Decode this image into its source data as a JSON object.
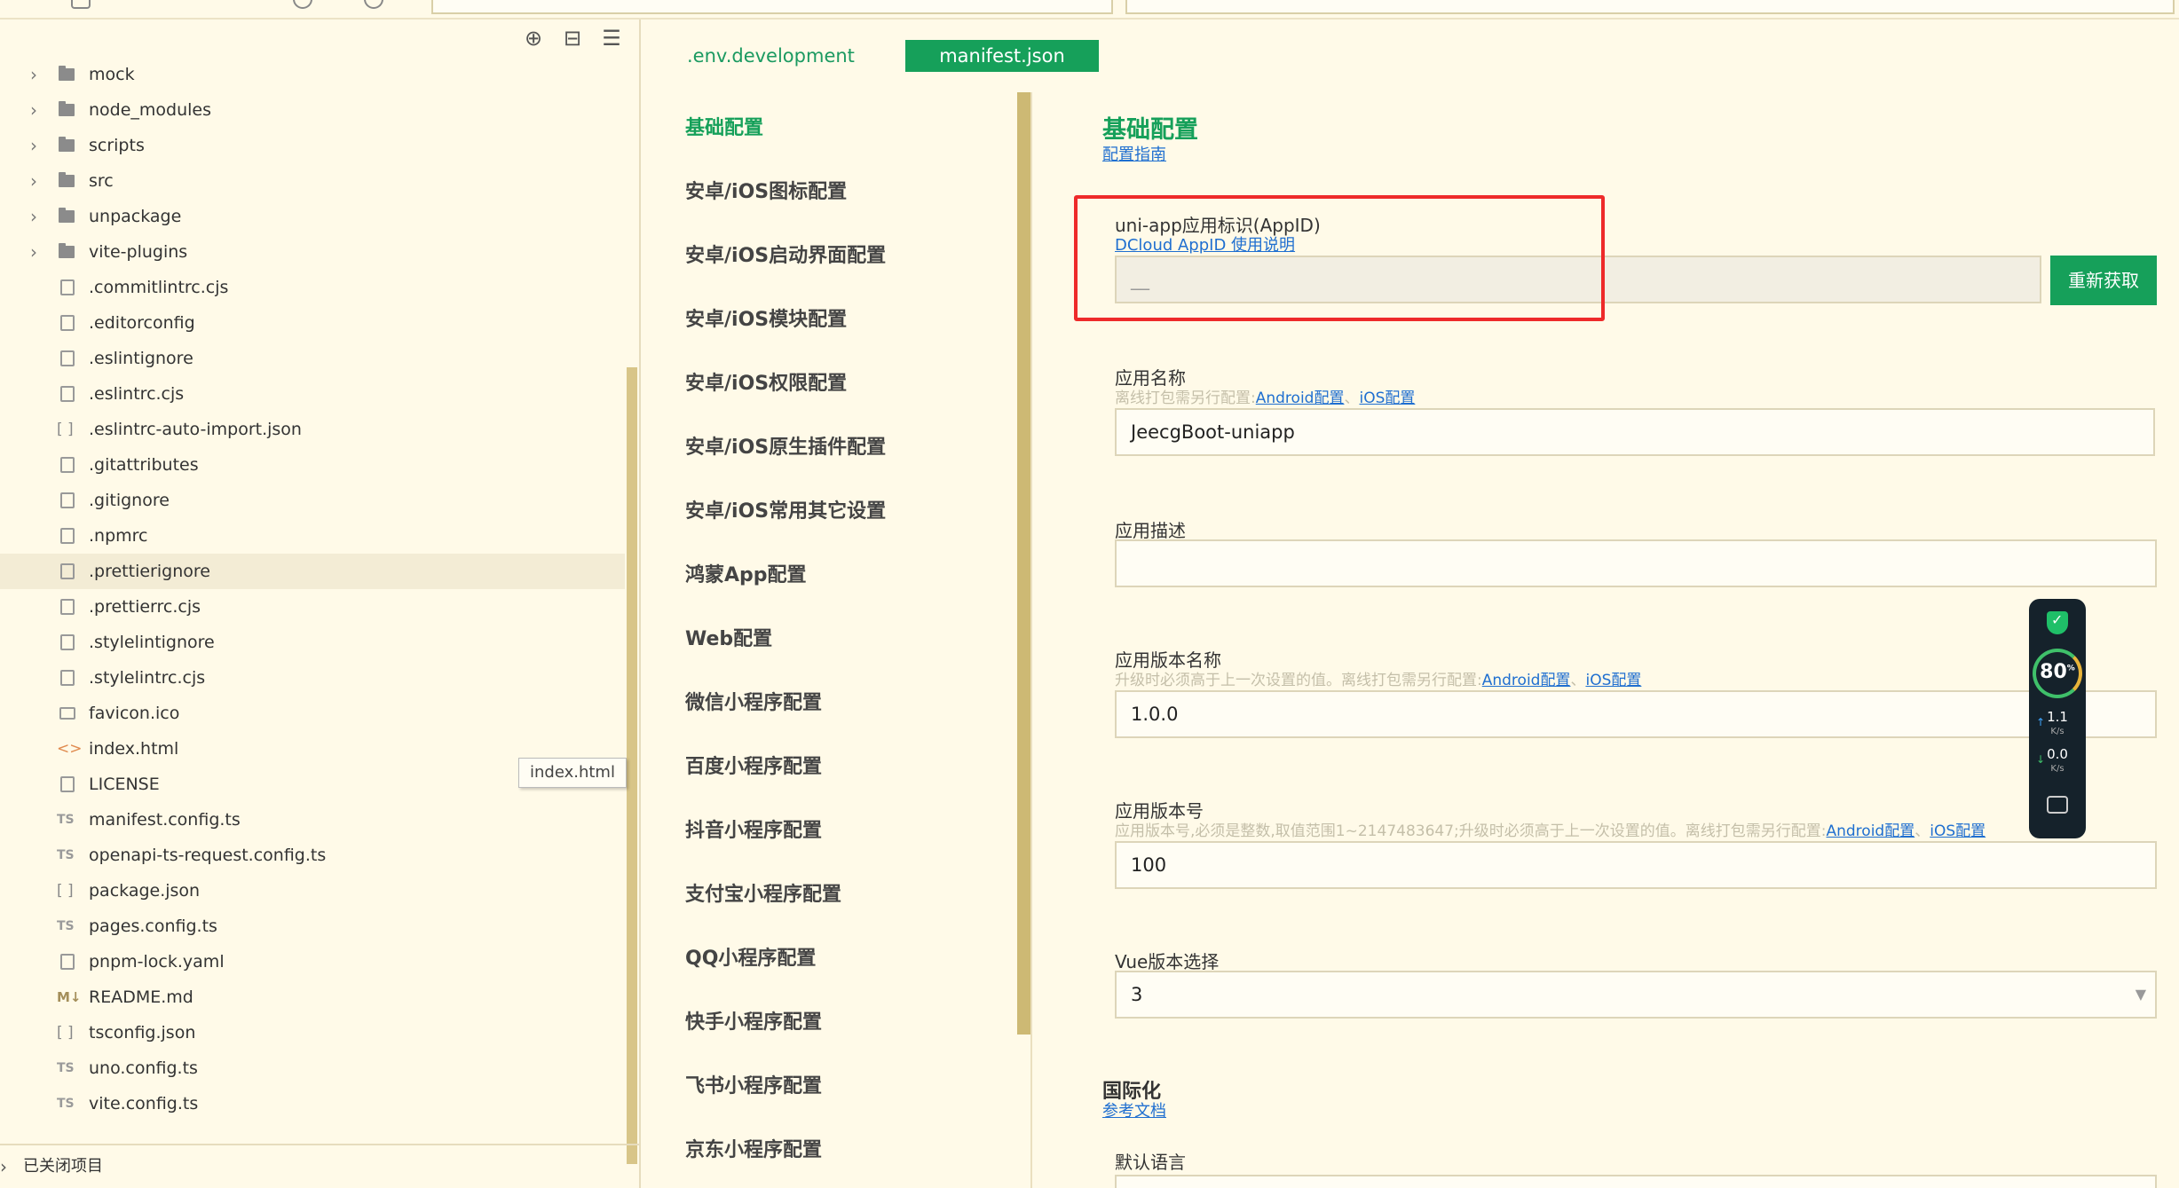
{
  "explorer": {
    "items": [
      {
        "label": "mock",
        "kind": "folder",
        "expandable": true
      },
      {
        "label": "node_modules",
        "kind": "folder",
        "expandable": true
      },
      {
        "label": "scripts",
        "kind": "folder",
        "expandable": true
      },
      {
        "label": "src",
        "kind": "folder",
        "expandable": true
      },
      {
        "label": "unpackage",
        "kind": "folder",
        "expandable": true
      },
      {
        "label": "vite-plugins",
        "kind": "folder",
        "expandable": true
      },
      {
        "label": ".commitlintrc.cjs",
        "kind": "file"
      },
      {
        "label": ".editorconfig",
        "kind": "file"
      },
      {
        "label": ".eslintignore",
        "kind": "file"
      },
      {
        "label": ".eslintrc.cjs",
        "kind": "file"
      },
      {
        "label": ".eslintrc-auto-import.json",
        "kind": "json",
        "glyph": "[ ]"
      },
      {
        "label": ".gitattributes",
        "kind": "file"
      },
      {
        "label": ".gitignore",
        "kind": "file"
      },
      {
        "label": ".npmrc",
        "kind": "file"
      },
      {
        "label": ".prettierignore",
        "kind": "file",
        "selected": true
      },
      {
        "label": ".prettierrc.cjs",
        "kind": "file"
      },
      {
        "label": ".stylelintignore",
        "kind": "file"
      },
      {
        "label": ".stylelintrc.cjs",
        "kind": "file"
      },
      {
        "label": "favicon.ico",
        "kind": "img"
      },
      {
        "label": "index.html",
        "kind": "html",
        "glyph": "<>"
      },
      {
        "label": "LICENSE",
        "kind": "file"
      },
      {
        "label": "manifest.config.ts",
        "kind": "ts",
        "glyph": "TS"
      },
      {
        "label": "openapi-ts-request.config.ts",
        "kind": "ts",
        "glyph": "TS"
      },
      {
        "label": "package.json",
        "kind": "json",
        "glyph": "[ ]"
      },
      {
        "label": "pages.config.ts",
        "kind": "ts",
        "glyph": "TS"
      },
      {
        "label": "pnpm-lock.yaml",
        "kind": "file"
      },
      {
        "label": "README.md",
        "kind": "md",
        "glyph": "M↓"
      },
      {
        "label": "tsconfig.json",
        "kind": "json",
        "glyph": "[ ]"
      },
      {
        "label": "uno.config.ts",
        "kind": "ts",
        "glyph": "TS"
      },
      {
        "label": "vite.config.ts",
        "kind": "ts",
        "glyph": "TS"
      }
    ],
    "tooltip": "index.html",
    "closed_projects_label": "已关闭项目"
  },
  "tabs": [
    {
      "label": ".env.development",
      "active": false
    },
    {
      "label": "manifest.json",
      "active": true
    }
  ],
  "nav": {
    "items": [
      {
        "label": "基础配置",
        "active": true
      },
      {
        "label": "安卓/iOS图标配置"
      },
      {
        "label": "安卓/iOS启动界面配置"
      },
      {
        "label": "安卓/iOS模块配置"
      },
      {
        "label": "安卓/iOS权限配置"
      },
      {
        "label": "安卓/iOS原生插件配置"
      },
      {
        "label": "安卓/iOS常用其它设置"
      },
      {
        "label": "鸿蒙App配置"
      },
      {
        "label": "Web配置"
      },
      {
        "label": "微信小程序配置"
      },
      {
        "label": "百度小程序配置"
      },
      {
        "label": "抖音小程序配置"
      },
      {
        "label": "支付宝小程序配置"
      },
      {
        "label": "QQ小程序配置"
      },
      {
        "label": "快手小程序配置"
      },
      {
        "label": "飞书小程序配置"
      },
      {
        "label": "京东小程序配置"
      }
    ]
  },
  "basic": {
    "title": "基础配置",
    "guide_link": "配置指南",
    "appid": {
      "label": "uni-app应用标识(AppID)",
      "help_link": "DCloud AppID 使用说明",
      "value": "__",
      "refresh_button": "重新获取"
    },
    "app_name": {
      "label": "应用名称",
      "hint": "离线打包需另行配置:",
      "android_link": "Android配置",
      "sep": "、",
      "ios_link": "iOS配置",
      "value": "JeecgBoot-uniapp"
    },
    "app_desc": {
      "label": "应用描述",
      "value": ""
    },
    "version_name": {
      "label": "应用版本名称",
      "hint": "升级时必须高于上一次设置的值。离线打包需另行配置:",
      "android_link": "Android配置",
      "sep": "、",
      "ios_link": "iOS配置",
      "value": "1.0.0"
    },
    "version_code": {
      "label": "应用版本号",
      "hint": "应用版本号,必须是整数,取值范围1~2147483647;升级时必须高于上一次设置的值。离线打包需另行配置:",
      "android_link": "Android配置",
      "sep": "、",
      "ios_link": "iOS配置",
      "value": "100"
    },
    "vue_version": {
      "label": "Vue版本选择",
      "value": "3"
    }
  },
  "i18n": {
    "title": "国际化",
    "doc_link": "参考文档",
    "default_lang_label": "默认语言"
  },
  "monitor": {
    "percent": "80",
    "percent_unit": "%",
    "up_rate": "1.1",
    "up_unit": "K/s",
    "down_rate": "0.0",
    "down_unit": "K/s"
  },
  "colors": {
    "accent": "#16a05a",
    "background": "#fffae8",
    "link": "#1f6fd0",
    "highlight": "#ee2a2a"
  }
}
